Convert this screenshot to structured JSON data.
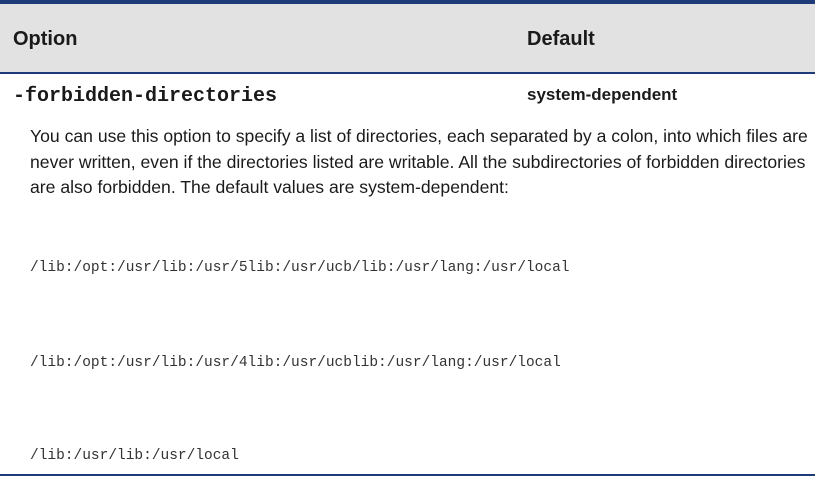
{
  "table": {
    "headers": {
      "option": "Option",
      "default": "Default"
    },
    "row": {
      "option_name": "-forbidden-directories",
      "default_value": "system-dependent",
      "description": "You can use this option to specify a list of directories, each separated by a colon, into which files are never written, even if the directories listed are writable. All the subdirectories of forbidden directories are also forbidden. The default values are system-dependent:",
      "paths": [
        "/lib:/opt:/usr/lib:/usr/5lib:/usr/ucb/lib:/usr/lang:/usr/local",
        "/lib:/opt:/usr/lib:/usr/4lib:/usr/ucblib:/usr/lang:/usr/local",
        "/lib:/usr/lib:/usr/local"
      ]
    }
  },
  "colors": {
    "rule": "#1e3a78",
    "header_background": "#e2e2e2",
    "text": "#1a1a1a"
  }
}
